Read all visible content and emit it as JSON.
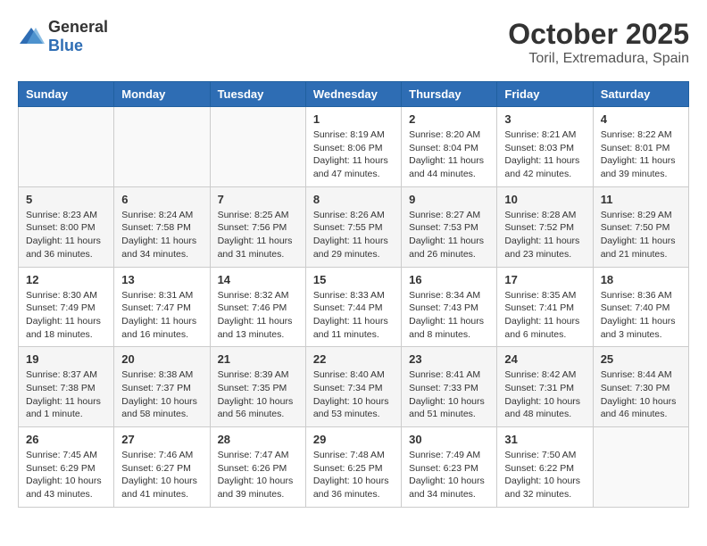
{
  "header": {
    "logo_general": "General",
    "logo_blue": "Blue",
    "month": "October 2025",
    "location": "Toril, Extremadura, Spain"
  },
  "weekdays": [
    "Sunday",
    "Monday",
    "Tuesday",
    "Wednesday",
    "Thursday",
    "Friday",
    "Saturday"
  ],
  "weeks": [
    [
      {
        "day": "",
        "info": ""
      },
      {
        "day": "",
        "info": ""
      },
      {
        "day": "",
        "info": ""
      },
      {
        "day": "1",
        "info": "Sunrise: 8:19 AM\nSunset: 8:06 PM\nDaylight: 11 hours and 47 minutes."
      },
      {
        "day": "2",
        "info": "Sunrise: 8:20 AM\nSunset: 8:04 PM\nDaylight: 11 hours and 44 minutes."
      },
      {
        "day": "3",
        "info": "Sunrise: 8:21 AM\nSunset: 8:03 PM\nDaylight: 11 hours and 42 minutes."
      },
      {
        "day": "4",
        "info": "Sunrise: 8:22 AM\nSunset: 8:01 PM\nDaylight: 11 hours and 39 minutes."
      }
    ],
    [
      {
        "day": "5",
        "info": "Sunrise: 8:23 AM\nSunset: 8:00 PM\nDaylight: 11 hours and 36 minutes."
      },
      {
        "day": "6",
        "info": "Sunrise: 8:24 AM\nSunset: 7:58 PM\nDaylight: 11 hours and 34 minutes."
      },
      {
        "day": "7",
        "info": "Sunrise: 8:25 AM\nSunset: 7:56 PM\nDaylight: 11 hours and 31 minutes."
      },
      {
        "day": "8",
        "info": "Sunrise: 8:26 AM\nSunset: 7:55 PM\nDaylight: 11 hours and 29 minutes."
      },
      {
        "day": "9",
        "info": "Sunrise: 8:27 AM\nSunset: 7:53 PM\nDaylight: 11 hours and 26 minutes."
      },
      {
        "day": "10",
        "info": "Sunrise: 8:28 AM\nSunset: 7:52 PM\nDaylight: 11 hours and 23 minutes."
      },
      {
        "day": "11",
        "info": "Sunrise: 8:29 AM\nSunset: 7:50 PM\nDaylight: 11 hours and 21 minutes."
      }
    ],
    [
      {
        "day": "12",
        "info": "Sunrise: 8:30 AM\nSunset: 7:49 PM\nDaylight: 11 hours and 18 minutes."
      },
      {
        "day": "13",
        "info": "Sunrise: 8:31 AM\nSunset: 7:47 PM\nDaylight: 11 hours and 16 minutes."
      },
      {
        "day": "14",
        "info": "Sunrise: 8:32 AM\nSunset: 7:46 PM\nDaylight: 11 hours and 13 minutes."
      },
      {
        "day": "15",
        "info": "Sunrise: 8:33 AM\nSunset: 7:44 PM\nDaylight: 11 hours and 11 minutes."
      },
      {
        "day": "16",
        "info": "Sunrise: 8:34 AM\nSunset: 7:43 PM\nDaylight: 11 hours and 8 minutes."
      },
      {
        "day": "17",
        "info": "Sunrise: 8:35 AM\nSunset: 7:41 PM\nDaylight: 11 hours and 6 minutes."
      },
      {
        "day": "18",
        "info": "Sunrise: 8:36 AM\nSunset: 7:40 PM\nDaylight: 11 hours and 3 minutes."
      }
    ],
    [
      {
        "day": "19",
        "info": "Sunrise: 8:37 AM\nSunset: 7:38 PM\nDaylight: 11 hours and 1 minute."
      },
      {
        "day": "20",
        "info": "Sunrise: 8:38 AM\nSunset: 7:37 PM\nDaylight: 10 hours and 58 minutes."
      },
      {
        "day": "21",
        "info": "Sunrise: 8:39 AM\nSunset: 7:35 PM\nDaylight: 10 hours and 56 minutes."
      },
      {
        "day": "22",
        "info": "Sunrise: 8:40 AM\nSunset: 7:34 PM\nDaylight: 10 hours and 53 minutes."
      },
      {
        "day": "23",
        "info": "Sunrise: 8:41 AM\nSunset: 7:33 PM\nDaylight: 10 hours and 51 minutes."
      },
      {
        "day": "24",
        "info": "Sunrise: 8:42 AM\nSunset: 7:31 PM\nDaylight: 10 hours and 48 minutes."
      },
      {
        "day": "25",
        "info": "Sunrise: 8:44 AM\nSunset: 7:30 PM\nDaylight: 10 hours and 46 minutes."
      }
    ],
    [
      {
        "day": "26",
        "info": "Sunrise: 7:45 AM\nSunset: 6:29 PM\nDaylight: 10 hours and 43 minutes."
      },
      {
        "day": "27",
        "info": "Sunrise: 7:46 AM\nSunset: 6:27 PM\nDaylight: 10 hours and 41 minutes."
      },
      {
        "day": "28",
        "info": "Sunrise: 7:47 AM\nSunset: 6:26 PM\nDaylight: 10 hours and 39 minutes."
      },
      {
        "day": "29",
        "info": "Sunrise: 7:48 AM\nSunset: 6:25 PM\nDaylight: 10 hours and 36 minutes."
      },
      {
        "day": "30",
        "info": "Sunrise: 7:49 AM\nSunset: 6:23 PM\nDaylight: 10 hours and 34 minutes."
      },
      {
        "day": "31",
        "info": "Sunrise: 7:50 AM\nSunset: 6:22 PM\nDaylight: 10 hours and 32 minutes."
      },
      {
        "day": "",
        "info": ""
      }
    ]
  ]
}
